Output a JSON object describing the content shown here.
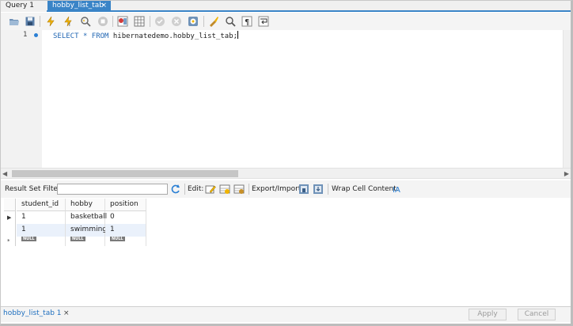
{
  "tabs": [
    {
      "label": "Query 1",
      "active": false
    },
    {
      "label": "hobby_list_tab",
      "active": true,
      "close": "×"
    }
  ],
  "toolbar": {
    "icons": [
      "open-folder-icon",
      "save-icon",
      "execute-icon",
      "execute-line-icon",
      "explain-icon",
      "stop-icon",
      "toggle-output-icon",
      "grid-icon",
      "commit-icon",
      "rollback-icon",
      "autocommit-icon",
      "beautify-icon",
      "find-icon",
      "invisible-chars-icon",
      "wrap-icon"
    ]
  },
  "editor": {
    "line_number": "1",
    "sql_keyword_1": "SELECT",
    "sql_star": "*",
    "sql_keyword_2": "FROM",
    "sql_table": "hibernatedemo.hobby_list_tab;"
  },
  "result_toolbar": {
    "filter_label": "Result Set Filter:",
    "filter_value": "",
    "edit_label": "Edit:",
    "export_label": "Export/Import:",
    "wrap_label": "Wrap Cell Content:"
  },
  "grid": {
    "columns": [
      "student_id",
      "hobby",
      "position"
    ],
    "rows": [
      [
        "1",
        "basketball",
        "0"
      ],
      [
        "1",
        "swimming",
        "1"
      ]
    ],
    "null_label": "NULL",
    "new_row_marker": "*"
  },
  "bottom": {
    "result_tab": "hobby_list_tab 1",
    "result_tab_close": "×",
    "apply_label": "Apply",
    "cancel_label": "Cancel"
  },
  "colors": {
    "accent": "#3a84c7",
    "keyword": "#2468b4",
    "alt_row": "#eaf1fb"
  }
}
